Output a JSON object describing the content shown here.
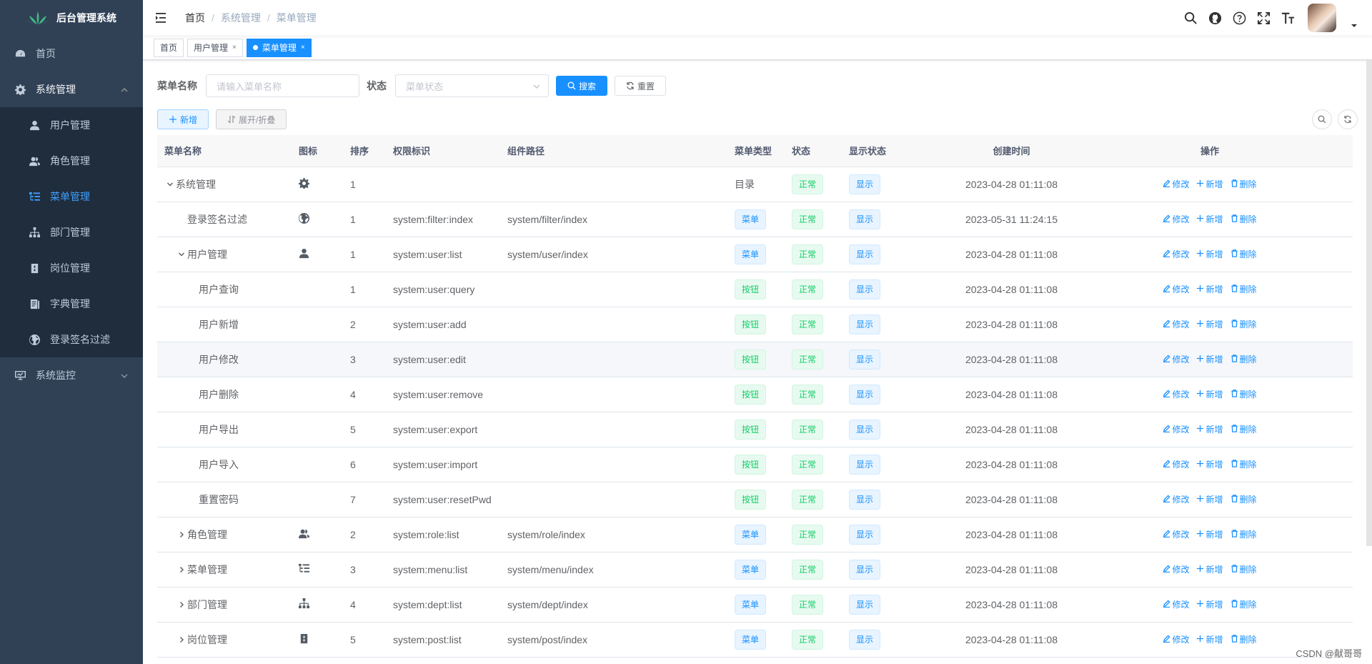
{
  "sidebar": {
    "title": "后台管理系统",
    "items": [
      {
        "label": "首页",
        "icon": "dashboard-icon"
      },
      {
        "label": "系统管理",
        "icon": "gear-icon",
        "children": [
          {
            "label": "用户管理",
            "icon": "user-icon"
          },
          {
            "label": "角色管理",
            "icon": "peoples-icon"
          },
          {
            "label": "菜单管理",
            "icon": "tree-table-icon",
            "active": true
          },
          {
            "label": "部门管理",
            "icon": "tree-icon"
          },
          {
            "label": "岗位管理",
            "icon": "post-icon"
          },
          {
            "label": "字典管理",
            "icon": "dict-icon"
          },
          {
            "label": "登录签名过滤",
            "icon": "globe-icon"
          }
        ]
      },
      {
        "label": "系统监控",
        "icon": "monitor-icon"
      }
    ]
  },
  "breadcrumb": [
    "首页",
    "系统管理",
    "菜单管理"
  ],
  "tags": [
    {
      "label": "首页"
    },
    {
      "label": "用户管理"
    },
    {
      "label": "菜单管理",
      "active": true
    }
  ],
  "search": {
    "name_label": "菜单名称",
    "name_placeholder": "请输入菜单名称",
    "status_label": "状态",
    "status_placeholder": "菜单状态",
    "search_btn": "搜索",
    "reset_btn": "重置"
  },
  "toolbar": {
    "add_btn": "新增",
    "expand_btn": "展开/折叠"
  },
  "table": {
    "columns": [
      "菜单名称",
      "图标",
      "排序",
      "权限标识",
      "组件路径",
      "菜单类型",
      "状态",
      "显示状态",
      "创建时间",
      "操作"
    ],
    "ops": {
      "edit": "修改",
      "add": "新增",
      "delete": "删除"
    },
    "rows": [
      {
        "name": "系统管理",
        "level": 0,
        "expander": "down",
        "icon": "gear-icon",
        "sort": "1",
        "perm": "",
        "path": "",
        "type": "目录",
        "type_tag": false,
        "status": "正常",
        "visible": "显示",
        "time": "2023-04-28 01:11:08"
      },
      {
        "name": "登录签名过滤",
        "level": 1,
        "expander": "",
        "icon": "globe-icon",
        "sort": "1",
        "perm": "system:filter:index",
        "path": "system/filter/index",
        "type": "菜单",
        "type_tag": "blue",
        "status": "正常",
        "visible": "显示",
        "time": "2023-05-31 11:24:15"
      },
      {
        "name": "用户管理",
        "level": 1,
        "expander": "down",
        "icon": "user-icon",
        "sort": "1",
        "perm": "system:user:list",
        "path": "system/user/index",
        "type": "菜单",
        "type_tag": "blue",
        "status": "正常",
        "visible": "显示",
        "time": "2023-04-28 01:11:08"
      },
      {
        "name": "用户查询",
        "level": 2,
        "expander": "",
        "icon": "",
        "sort": "1",
        "perm": "system:user:query",
        "path": "",
        "type": "按钮",
        "type_tag": "green",
        "status": "正常",
        "visible": "显示",
        "time": "2023-04-28 01:11:08"
      },
      {
        "name": "用户新增",
        "level": 2,
        "expander": "",
        "icon": "",
        "sort": "2",
        "perm": "system:user:add",
        "path": "",
        "type": "按钮",
        "type_tag": "green",
        "status": "正常",
        "visible": "显示",
        "time": "2023-04-28 01:11:08"
      },
      {
        "name": "用户修改",
        "level": 2,
        "expander": "",
        "icon": "",
        "sort": "3",
        "perm": "system:user:edit",
        "path": "",
        "type": "按钮",
        "type_tag": "green",
        "status": "正常",
        "visible": "显示",
        "time": "2023-04-28 01:11:08",
        "hover": true
      },
      {
        "name": "用户删除",
        "level": 2,
        "expander": "",
        "icon": "",
        "sort": "4",
        "perm": "system:user:remove",
        "path": "",
        "type": "按钮",
        "type_tag": "green",
        "status": "正常",
        "visible": "显示",
        "time": "2023-04-28 01:11:08"
      },
      {
        "name": "用户导出",
        "level": 2,
        "expander": "",
        "icon": "",
        "sort": "5",
        "perm": "system:user:export",
        "path": "",
        "type": "按钮",
        "type_tag": "green",
        "status": "正常",
        "visible": "显示",
        "time": "2023-04-28 01:11:08"
      },
      {
        "name": "用户导入",
        "level": 2,
        "expander": "",
        "icon": "",
        "sort": "6",
        "perm": "system:user:import",
        "path": "",
        "type": "按钮",
        "type_tag": "green",
        "status": "正常",
        "visible": "显示",
        "time": "2023-04-28 01:11:08"
      },
      {
        "name": "重置密码",
        "level": 2,
        "expander": "",
        "icon": "",
        "sort": "7",
        "perm": "system:user:resetPwd",
        "path": "",
        "type": "按钮",
        "type_tag": "green",
        "status": "正常",
        "visible": "显示",
        "time": "2023-04-28 01:11:08"
      },
      {
        "name": "角色管理",
        "level": 1,
        "expander": "right",
        "icon": "peoples-icon",
        "sort": "2",
        "perm": "system:role:list",
        "path": "system/role/index",
        "type": "菜单",
        "type_tag": "blue",
        "status": "正常",
        "visible": "显示",
        "time": "2023-04-28 01:11:08"
      },
      {
        "name": "菜单管理",
        "level": 1,
        "expander": "right",
        "icon": "tree-table-icon",
        "sort": "3",
        "perm": "system:menu:list",
        "path": "system/menu/index",
        "type": "菜单",
        "type_tag": "blue",
        "status": "正常",
        "visible": "显示",
        "time": "2023-04-28 01:11:08"
      },
      {
        "name": "部门管理",
        "level": 1,
        "expander": "right",
        "icon": "tree-icon",
        "sort": "4",
        "perm": "system:dept:list",
        "path": "system/dept/index",
        "type": "菜单",
        "type_tag": "blue",
        "status": "正常",
        "visible": "显示",
        "time": "2023-04-28 01:11:08"
      },
      {
        "name": "岗位管理",
        "level": 1,
        "expander": "right",
        "icon": "post-icon",
        "sort": "5",
        "perm": "system:post:list",
        "path": "system/post/index",
        "type": "菜单",
        "type_tag": "blue",
        "status": "正常",
        "visible": "显示",
        "time": "2023-04-28 01:11:08"
      }
    ]
  },
  "watermark": "CSDN @献哥哥",
  "colors": {
    "sidebar_bg": "#304156",
    "submenu_bg": "#1f2d3d",
    "primary": "#1890ff",
    "success": "#13ce66"
  }
}
